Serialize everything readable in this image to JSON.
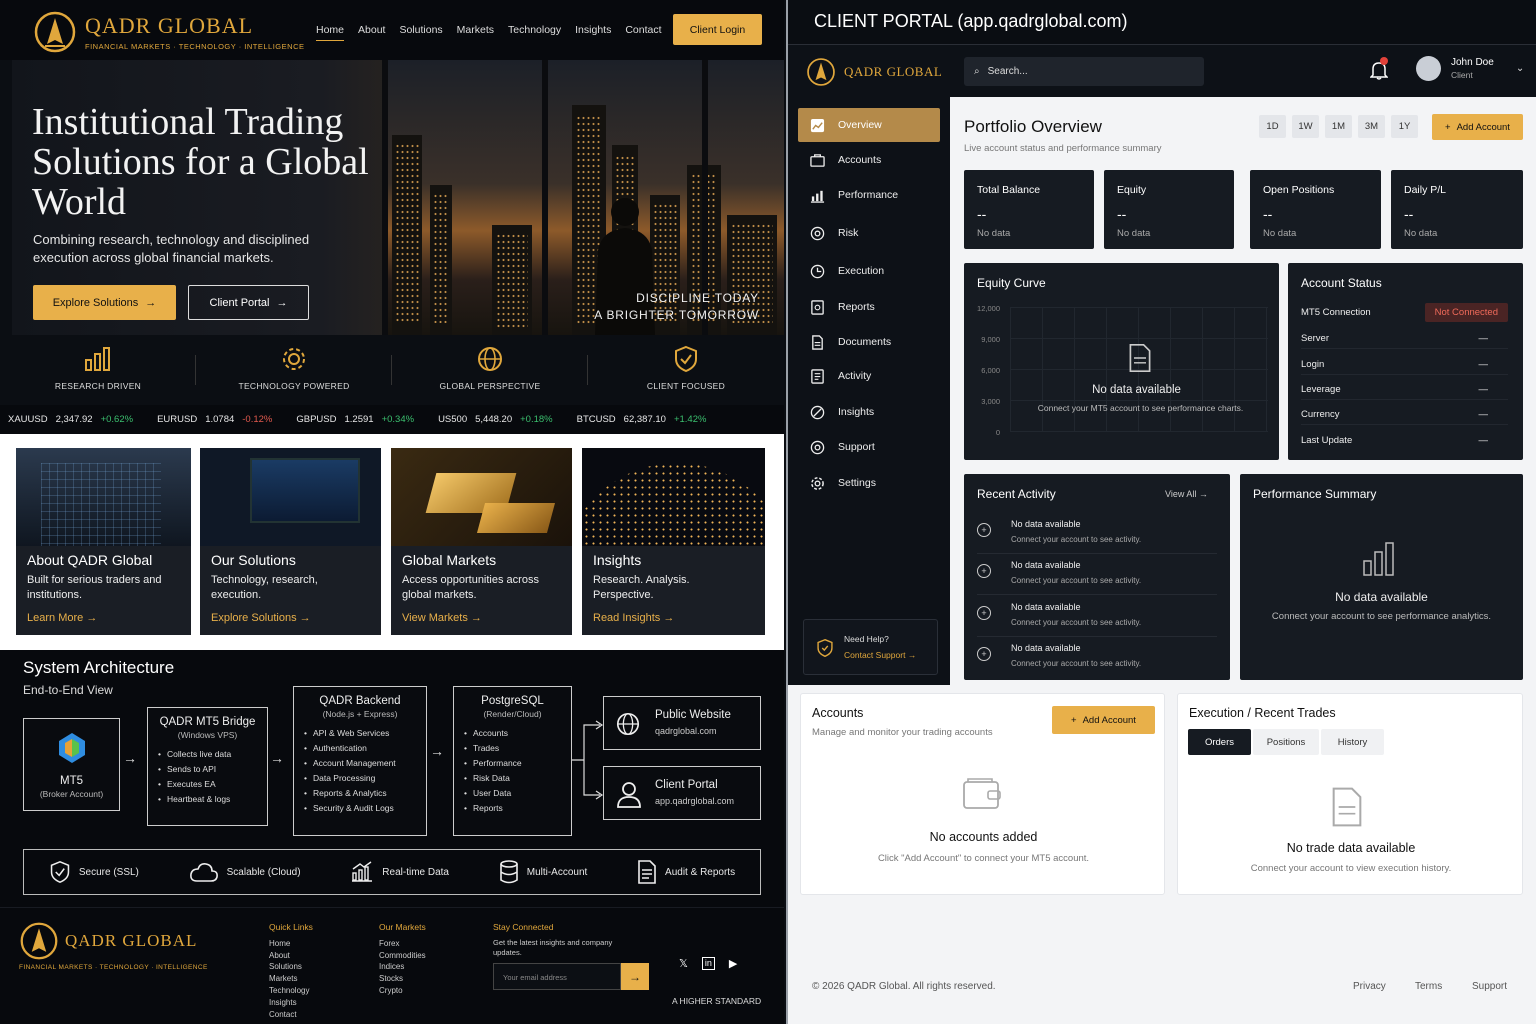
{
  "brand": {
    "name": "QADR GLOBAL",
    "tagline": "FINANCIAL MARKETS · TECHNOLOGY · INTELLIGENCE"
  },
  "nav": {
    "links": [
      "Home",
      "About",
      "Solutions",
      "Markets",
      "Technology",
      "Insights",
      "Contact"
    ],
    "active": "Home",
    "login": "Client Login"
  },
  "hero": {
    "title": "Institutional Trading Solutions for a Global World",
    "description": "Combining research, technology and disciplined execution across global financial markets.",
    "cta_primary": "Explore Solutions",
    "cta_secondary": "Client Portal",
    "tagline_1": "DISCIPLINE TODAY",
    "tagline_2": "A BRIGHTER TOMORROW"
  },
  "features": [
    {
      "label": "RESEARCH DRIVEN",
      "icon": "bar-chart-icon"
    },
    {
      "label": "TECHNOLOGY POWERED",
      "icon": "gear-icon"
    },
    {
      "label": "GLOBAL PERSPECTIVE",
      "icon": "globe-icon"
    },
    {
      "label": "CLIENT FOCUSED",
      "icon": "shield-check-icon"
    }
  ],
  "ticker": [
    {
      "sym": "XAUUSD",
      "price": "2,347.92",
      "chg": "+0.62%",
      "dir": "up"
    },
    {
      "sym": "EURUSD",
      "price": "1.0784",
      "chg": "-0.12%",
      "dir": "dn"
    },
    {
      "sym": "GBPUSD",
      "price": "1.2591",
      "chg": "+0.34%",
      "dir": "up"
    },
    {
      "sym": "US500",
      "price": "5,448.20",
      "chg": "+0.18%",
      "dir": "up"
    },
    {
      "sym": "BTCUSD",
      "price": "62,387.10",
      "chg": "+1.42%",
      "dir": "up"
    }
  ],
  "cards": [
    {
      "title": "About QADR Global",
      "desc": "Built for serious traders and institutions.",
      "link": "Learn More"
    },
    {
      "title": "Our Solutions",
      "desc": "Technology, research, execution.",
      "link": "Explore Solutions"
    },
    {
      "title": "Global Markets",
      "desc": "Access opportunities across global markets.",
      "link": "View Markets"
    },
    {
      "title": "Insights",
      "desc": "Research. Analysis. Perspective.",
      "link": "Read Insights"
    }
  ],
  "architecture": {
    "title": "System Architecture",
    "subtitle": "End-to-End View",
    "mt5": {
      "title": "MT5",
      "sub": "(Broker Account)"
    },
    "bridge": {
      "title": "QADR MT5 Bridge",
      "sub": "(Windows VPS)",
      "items": [
        "Collects live data",
        "Sends to API",
        "Executes EA",
        "Heartbeat & logs"
      ]
    },
    "backend": {
      "title": "QADR Backend",
      "sub": "(Node.js + Express)",
      "items": [
        "API & Web Services",
        "Authentication",
        "Account Management",
        "Data Processing",
        "Reports & Analytics",
        "Security & Audit Logs"
      ]
    },
    "db": {
      "title": "PostgreSQL",
      "sub": "(Render/Cloud)",
      "items": [
        "Accounts",
        "Trades",
        "Performance",
        "Risk Data",
        "User Data",
        "Reports"
      ]
    },
    "website": {
      "title": "Public Website",
      "url": "qadrglobal.com"
    },
    "portal": {
      "title": "Client Portal",
      "url": "app.qadrglobal.com"
    },
    "features": [
      "Secure (SSL)",
      "Scalable (Cloud)",
      "Real-time Data",
      "Multi-Account",
      "Audit & Reports"
    ]
  },
  "footer": {
    "quick_links_title": "Quick Links",
    "quick_links": [
      "Home",
      "About",
      "Solutions",
      "Markets",
      "Technology",
      "Insights",
      "Contact"
    ],
    "markets_title": "Our Markets",
    "markets": [
      "Forex",
      "Commodities",
      "Indices",
      "Stocks",
      "Crypto"
    ],
    "stay_title": "Stay Connected",
    "stay_desc": "Get the latest insights and company updates.",
    "email_placeholder": "Your email address",
    "motto": "A HIGHER STANDARD"
  },
  "portal": {
    "window_title": "CLIENT PORTAL (app.qadrglobal.com)",
    "search_placeholder": "Search...",
    "user": {
      "name": "John Doe",
      "role": "Client"
    },
    "sidebar": [
      "Overview",
      "Accounts",
      "Performance",
      "Risk",
      "Execution",
      "Reports",
      "Documents",
      "Activity",
      "Insights",
      "Support",
      "Settings"
    ],
    "help": {
      "title": "Need Help?",
      "link": "Contact Support"
    },
    "overview": {
      "title": "Portfolio Overview",
      "subtitle": "Live account status and performance summary",
      "ranges": [
        "1D",
        "1W",
        "1M",
        "3M",
        "1Y"
      ],
      "add_account": "Add Account"
    },
    "stats": [
      {
        "label": "Total Balance",
        "value": "--",
        "note": "No data"
      },
      {
        "label": "Equity",
        "value": "--",
        "note": "No data"
      },
      {
        "label": "Open Positions",
        "value": "--",
        "note": "No data"
      },
      {
        "label": "Daily P/L",
        "value": "--",
        "note": "No data"
      }
    ],
    "equity": {
      "title": "Equity Curve",
      "yticks": [
        "12,000",
        "9,000",
        "6,000",
        "3,000",
        "0"
      ],
      "empty": "No data available",
      "empty_sub": "Connect your MT5 account to see performance charts."
    },
    "status": {
      "title": "Account Status",
      "rows": [
        {
          "k": "MT5 Connection",
          "v": "Not Connected"
        },
        {
          "k": "Server",
          "v": "—"
        },
        {
          "k": "Login",
          "v": "—"
        },
        {
          "k": "Leverage",
          "v": "—"
        },
        {
          "k": "Currency",
          "v": "—"
        },
        {
          "k": "Last Update",
          "v": "—"
        }
      ]
    },
    "activity": {
      "title": "Recent Activity",
      "view_all": "View All",
      "items": [
        {
          "t": "No data available",
          "s": "Connect your account to see activity."
        },
        {
          "t": "No data available",
          "s": "Connect your account to see activity."
        },
        {
          "t": "No data available",
          "s": "Connect your account to see activity."
        },
        {
          "t": "No data available",
          "s": "Connect your account to see activity."
        }
      ]
    },
    "perf": {
      "title": "Performance Summary",
      "empty": "No data available",
      "empty_sub": "Connect your account to see performance analytics."
    },
    "accounts": {
      "title": "Accounts",
      "subtitle": "Manage and monitor your trading accounts",
      "add": "Add Account",
      "empty": "No accounts added",
      "empty_sub": "Click \"Add Account\" to connect your MT5 account."
    },
    "execution": {
      "title": "Execution / Recent Trades",
      "tabs": [
        "Orders",
        "Positions",
        "History"
      ],
      "empty": "No trade data available",
      "empty_sub": "Connect your account to view execution history."
    },
    "footer": {
      "copyright": "© 2026 QADR Global. All rights reserved.",
      "links": [
        "Privacy",
        "Terms",
        "Support"
      ]
    }
  },
  "colors": {
    "accent": "#e8b04a",
    "bg_dark": "#0b0e13",
    "up": "#3bbf6e",
    "down": "#e25a4e"
  }
}
